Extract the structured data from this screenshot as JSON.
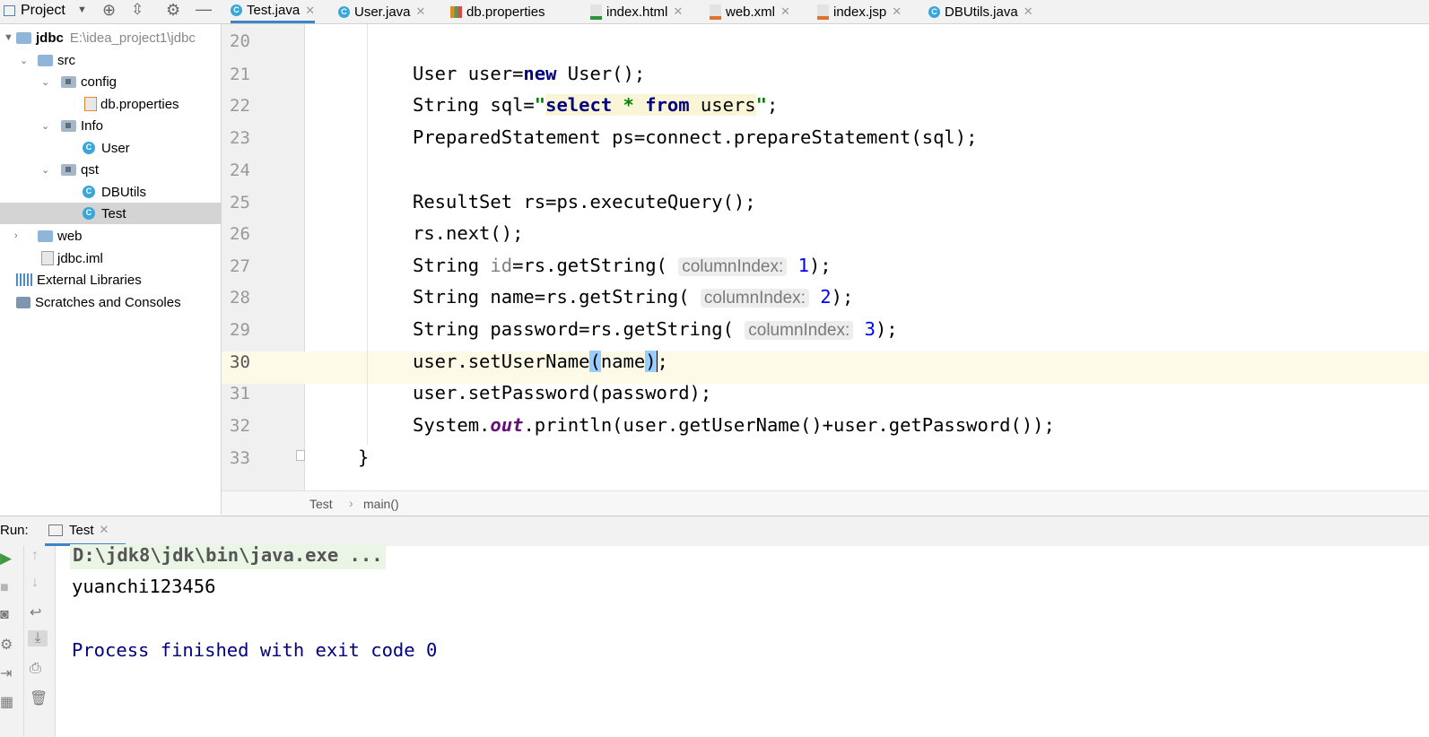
{
  "project_panel": {
    "title": "Project",
    "tree": [
      {
        "label": "jdbc",
        "path": "E:\\idea_project1\\jdbc"
      },
      {
        "label": "src"
      },
      {
        "label": "config"
      },
      {
        "label": "db.properties"
      },
      {
        "label": "Info"
      },
      {
        "label": "User"
      },
      {
        "label": "qst"
      },
      {
        "label": "DBUtils"
      },
      {
        "label": "Test",
        "selected": true
      },
      {
        "label": "web"
      },
      {
        "label": "jdbc.iml"
      },
      {
        "label": "External Libraries"
      },
      {
        "label": "Scratches and Consoles"
      }
    ]
  },
  "tabs": [
    {
      "label": "Test.java",
      "active": true,
      "icon": "class-run-icon"
    },
    {
      "label": "User.java",
      "icon": "class-icon"
    },
    {
      "label": "db.properties",
      "icon": "properties-icon"
    },
    {
      "label": "index.html",
      "icon": "html-icon"
    },
    {
      "label": "web.xml",
      "icon": "xml-icon"
    },
    {
      "label": "index.jsp",
      "icon": "jsp-icon"
    },
    {
      "label": "DBUtils.java",
      "icon": "class-icon"
    }
  ],
  "editor": {
    "line_numbers": [
      "20",
      "21",
      "22",
      "23",
      "24",
      "25",
      "26",
      "27",
      "28",
      "29",
      "30",
      "31",
      "32",
      "33"
    ],
    "current_line": "30",
    "hints": {
      "h1": "columnIndex:",
      "h2": "columnIndex:",
      "h3": "columnIndex:"
    }
  },
  "breadcrumb": {
    "class": "Test",
    "method": "main()"
  },
  "run": {
    "label": "Run:",
    "tab": "Test",
    "output": [
      "D:\\jdk8\\jdk\\bin\\java.exe ...",
      "yuanchi123456",
      "",
      "Process finished with exit code 0"
    ]
  },
  "colors": {
    "keyword": "#000080",
    "string": "#008000",
    "number": "#0000ff",
    "accent": "#4083c9"
  }
}
